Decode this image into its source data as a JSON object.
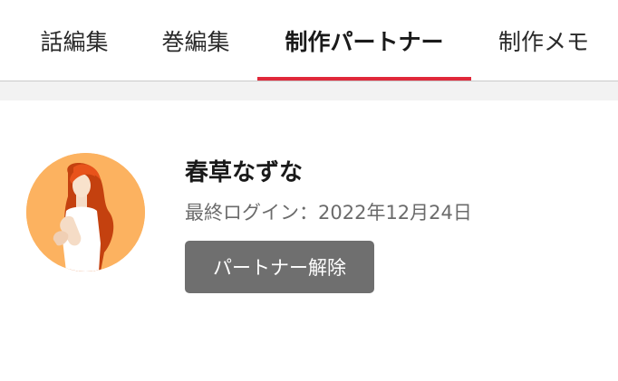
{
  "tabs": [
    {
      "label": "話編集"
    },
    {
      "label": "巻編集"
    },
    {
      "label": "制作パートナー"
    },
    {
      "label": "制作メモ"
    }
  ],
  "active_tab": "制作パートナー",
  "accent_color": "#e0283a",
  "partner": {
    "name": "春草なずな",
    "last_login": "最終ログイン：2022年12月24日",
    "unpartner_label": "パートナー解除",
    "avatar_icon": "woman-illustration-avatar",
    "avatar_bg": "#fcb260"
  }
}
